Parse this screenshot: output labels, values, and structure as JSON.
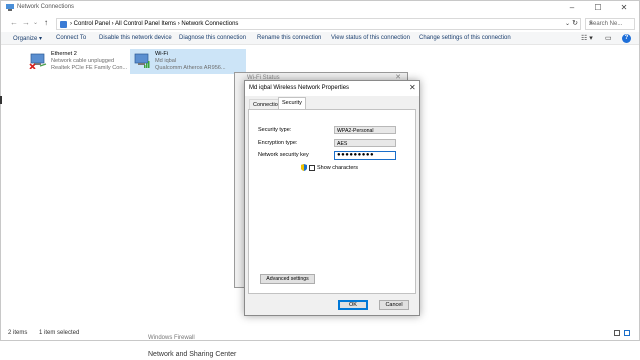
{
  "window": {
    "title": "Network Connections",
    "controls": {
      "minimize": "–",
      "maximize": "☐",
      "close": "✕"
    }
  },
  "addressbar": {
    "back": "←",
    "forward": "→",
    "recent": "⌄",
    "up": "↑",
    "crumbs": "›  Control Panel  ›  All Control Panel Items  ›  Network Connections",
    "dropdown": "⌄",
    "refresh": "↻",
    "search_placeholder": "Search Ne...",
    "search_icon": "⌕"
  },
  "toolbar": {
    "organize": "Organize ▾",
    "items": [
      "Connect To",
      "Disable this network device",
      "Diagnose this connection",
      "Rename this connection",
      "View status of this connection",
      "Change settings of this connection"
    ],
    "view_icon": "☷ ▾",
    "pane_icon": "▭",
    "help": "?"
  },
  "adapters": [
    {
      "name": "Ethernet 2",
      "status": "Network cable unplugged",
      "device": "Realtek PCIe FE Family Con...",
      "icon": "ethernet-disconnected-icon",
      "selected": false
    },
    {
      "name": "Wi-Fi",
      "status": "Md iqbal",
      "device": "Qualcomm Atheros AR956...",
      "icon": "wifi-adapter-icon",
      "selected": true
    }
  ],
  "statusbar": {
    "items": "2 items",
    "selected": "1 item selected"
  },
  "behind": {
    "line1": "Windows Firewall",
    "line2": "Network and Sharing Center"
  },
  "wifi_status_window": {
    "title": "Wi-Fi Status",
    "close": "✕"
  },
  "dialog": {
    "title": "Md iqbal Wireless Network Properties",
    "close": "✕",
    "tabs": [
      "Connection",
      "Security"
    ],
    "active_tab": "Security",
    "security_type_label": "Security type:",
    "security_type_value": "WPA2-Personal",
    "encryption_type_label": "Encryption type:",
    "encryption_type_value": "AES",
    "key_label": "Network security key",
    "key_value": "●●●●●●●●●",
    "show_characters": "Show characters",
    "advanced_button": "Advanced settings",
    "ok": "OK",
    "cancel": "Cancel"
  },
  "colors": {
    "selection": "#cce4f7",
    "accent": "#0078d7",
    "link": "#1a3e6e"
  }
}
